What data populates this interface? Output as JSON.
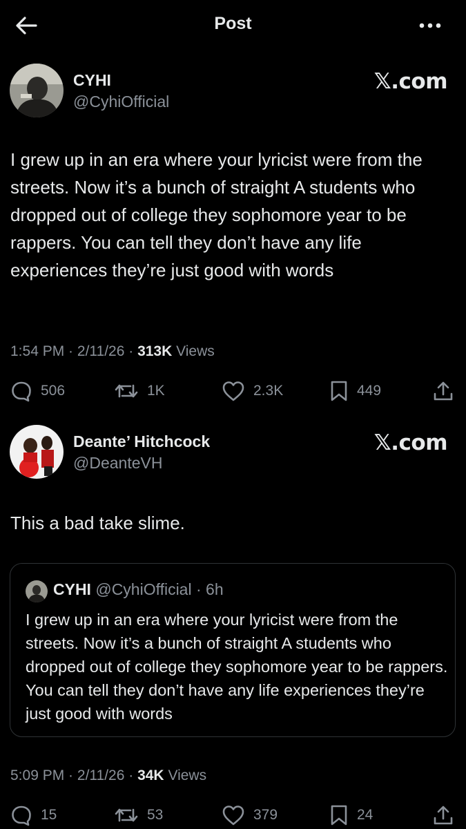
{
  "topbar": {
    "title": "Post"
  },
  "post1": {
    "name": "CYHI",
    "handle": "@CyhiOfficial",
    "source_logo": "𝕏.com",
    "text": "I grew up in an era where your lyricist were from the streets. Now it’s a bunch of straight A students who dropped out of college they sophomore year to be rappers. You can tell they don’t have any life experiences they’re just good with words",
    "time": "1:54 PM",
    "date": "2/11/26",
    "views_count": "313K",
    "views_label": "Views",
    "replies": "506",
    "reposts": "1K",
    "likes": "2.3K",
    "bookmarks": "449"
  },
  "post2": {
    "name": "Deante’ Hitchcock",
    "handle": "@DeanteVH",
    "source_logo": "𝕏.com",
    "text": "This a bad take slime.",
    "quote": {
      "name": "CYHI",
      "handle": "@CyhiOfficial",
      "age": "6h",
      "text": "I grew up in an era where your lyricist were from the streets. Now it’s a bunch of straight A students who dropped out of college they sophomore year to be rappers. You can tell they don’t have any life experiences they’re just good with words"
    },
    "time": "5:09 PM",
    "date": "2/11/26",
    "views_count": "34K",
    "views_label": "Views",
    "replies": "15",
    "reposts": "53",
    "likes": "379",
    "bookmarks": "24"
  },
  "icons": {
    "back": "arrow-left-icon",
    "more": "more-dots-icon",
    "reply": "reply-bubble-icon",
    "repost": "repost-arrows-icon",
    "like": "heart-icon",
    "bookmark": "bookmark-icon",
    "share": "share-upload-icon"
  },
  "colors": {
    "background": "#000000",
    "text": "#e7e9ea",
    "muted": "#8b9199",
    "border": "#2f3336"
  }
}
